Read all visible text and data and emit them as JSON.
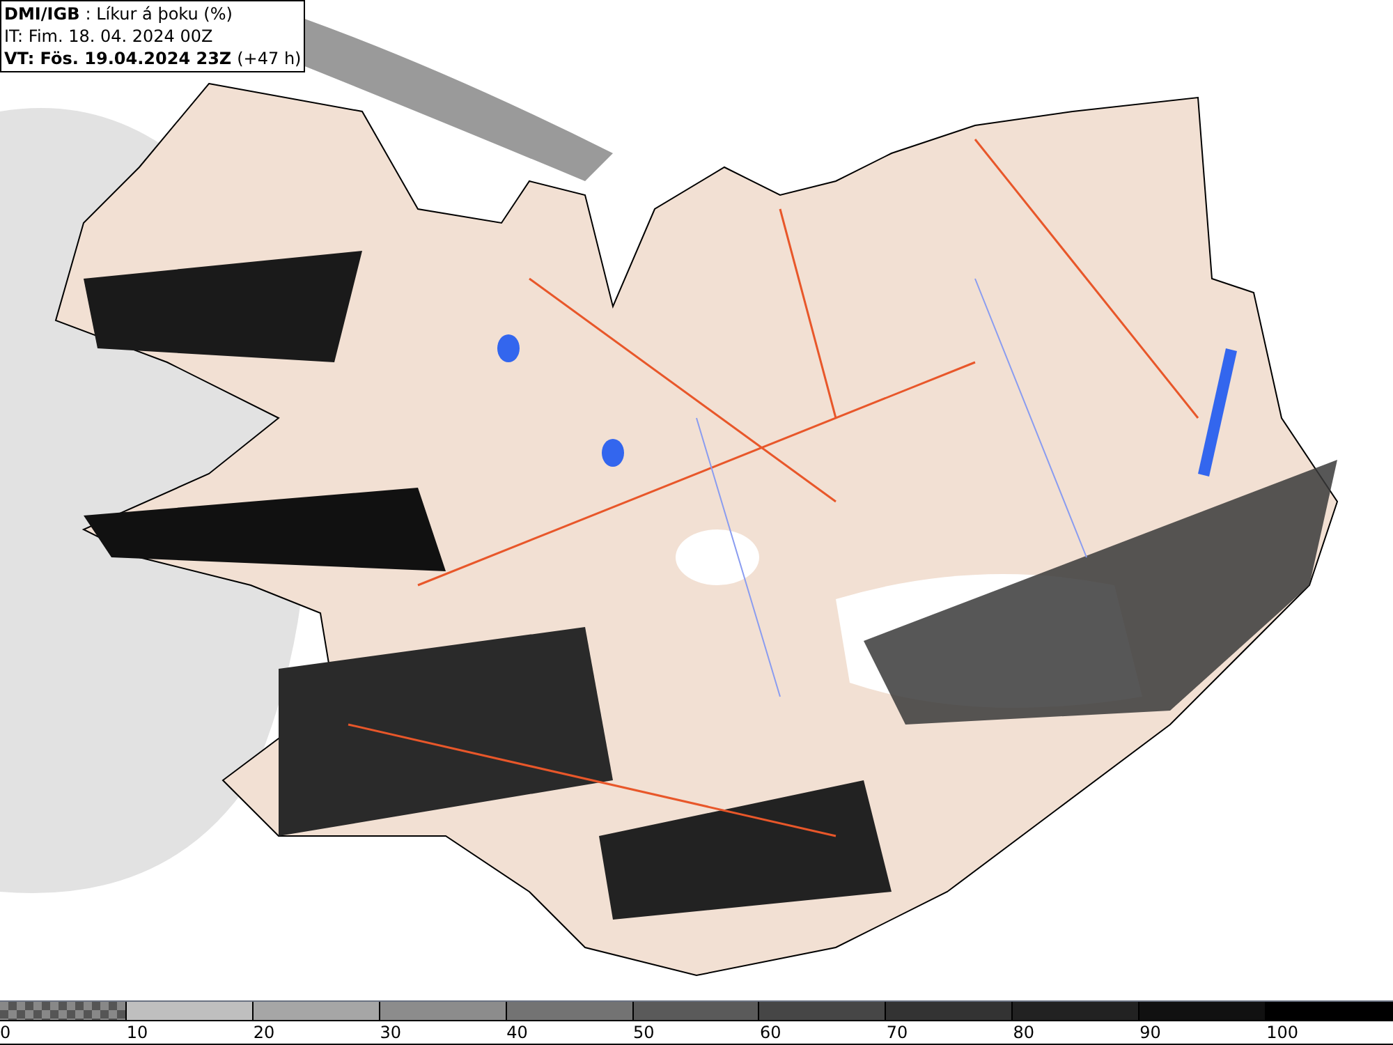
{
  "header": {
    "source": "DMI/IGB",
    "title": ": Líkur á þoku (%)",
    "issue_time": "IT: Fim. 18. 04. 2024 00Z",
    "valid_time": "VT: Fös. 19.04.2024 23Z",
    "lead": "(+47 h)"
  },
  "legend": {
    "segments": [
      {
        "kind": "checker"
      },
      {
        "kind": "solid",
        "color": "#bfbfbf"
      },
      {
        "kind": "solid",
        "color": "#a6a6a6"
      },
      {
        "kind": "solid",
        "color": "#8c8c8c"
      },
      {
        "kind": "solid",
        "color": "#737373"
      },
      {
        "kind": "solid",
        "color": "#5a5a5a"
      },
      {
        "kind": "solid",
        "color": "#464646"
      },
      {
        "kind": "solid",
        "color": "#333333"
      },
      {
        "kind": "solid",
        "color": "#222222"
      },
      {
        "kind": "solid",
        "color": "#111111"
      },
      {
        "kind": "solid",
        "color": "#000000"
      }
    ],
    "labels": [
      "0",
      "10",
      "20",
      "30",
      "40",
      "50",
      "60",
      "70",
      "80",
      "90",
      "100"
    ]
  }
}
